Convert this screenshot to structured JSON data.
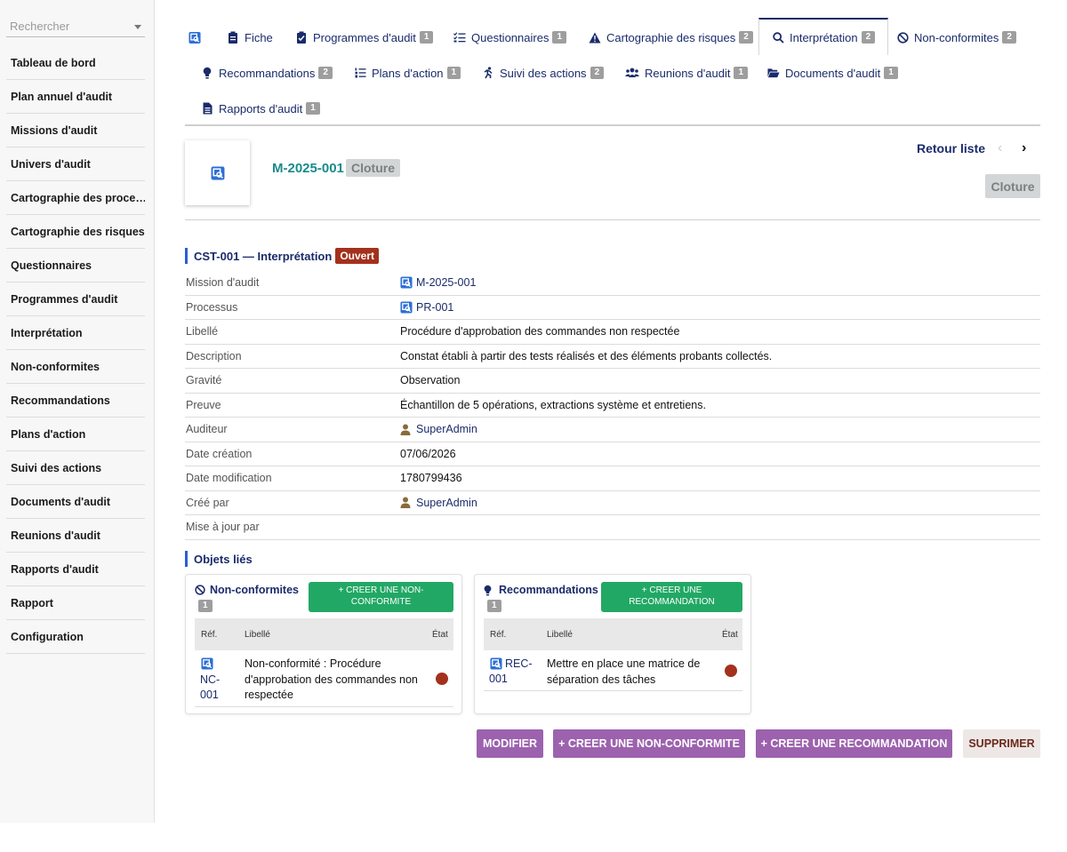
{
  "sidebar": {
    "search_placeholder": "Rechercher",
    "items": [
      {
        "label": "Tableau de bord"
      },
      {
        "label": "Plan annuel d'audit"
      },
      {
        "label": "Missions d'audit"
      },
      {
        "label": "Univers d'audit"
      },
      {
        "label": "Cartographie des proce…"
      },
      {
        "label": "Cartographie des risques"
      },
      {
        "label": "Questionnaires"
      },
      {
        "label": "Programmes d'audit"
      },
      {
        "label": "Interprétation"
      },
      {
        "label": "Non-conformites"
      },
      {
        "label": "Recommandations"
      },
      {
        "label": "Plans d'action"
      },
      {
        "label": "Suivi des actions"
      },
      {
        "label": "Documents d'audit"
      },
      {
        "label": "Reunions d'audit"
      },
      {
        "label": "Rapports d'audit"
      },
      {
        "label": "Rapport"
      },
      {
        "label": "Configuration"
      }
    ]
  },
  "tabs": [
    {
      "label": "Fiche",
      "badge": ""
    },
    {
      "label": "Programmes d'audit",
      "badge": "1"
    },
    {
      "label": "Questionnaires",
      "badge": "1"
    },
    {
      "label": "Cartographie des risques",
      "badge": "2"
    },
    {
      "label": "Interprétation",
      "badge": "2"
    },
    {
      "label": "Non-conformites",
      "badge": "2"
    },
    {
      "label": "Recommandations",
      "badge": "2"
    },
    {
      "label": "Plans d'action",
      "badge": "1"
    },
    {
      "label": "Suivi des actions",
      "badge": "2"
    },
    {
      "label": "Reunions d'audit",
      "badge": "1"
    },
    {
      "label": "Documents d'audit",
      "badge": "1"
    },
    {
      "label": "Rapports d'audit",
      "badge": "1"
    }
  ],
  "header": {
    "code": "M-2025-001",
    "status": "Cloture",
    "back_label": "Retour liste",
    "prev_glyph": "‹",
    "next_glyph": "›",
    "status_button": "Cloture"
  },
  "section": {
    "title": "CST-001 — Interprétation",
    "badge": "Ouvert"
  },
  "details": [
    {
      "label": "Mission d'audit",
      "value": "M-2025-001"
    },
    {
      "label": "Processus",
      "value": "PR-001"
    },
    {
      "label": "Libellé",
      "value": "Procédure d'approbation des commandes non respectée"
    },
    {
      "label": "Description",
      "value": "Constat établi à partir des tests réalisés et des éléments probants collectés."
    },
    {
      "label": "Gravité",
      "value": "Observation"
    },
    {
      "label": "Preuve",
      "value": "Échantillon de 5 opérations, extractions système et entretiens."
    },
    {
      "label": "Auditeur",
      "value": "SuperAdmin"
    },
    {
      "label": "Date création",
      "value": "07/06/2026"
    },
    {
      "label": "Date modification",
      "value": "1780799436"
    },
    {
      "label": "Créé par",
      "value": "SuperAdmin"
    },
    {
      "label": "Mise à jour par",
      "value": ""
    }
  ],
  "linked": {
    "title": "Objets liés",
    "nonconf": {
      "title": "Non-conformites",
      "count": "1",
      "create_line1": "+ CREER UNE NON-",
      "create_line2": "CONFORMITE",
      "col_ref": "Réf.",
      "col_label": "Libellé",
      "col_state": "État",
      "row_ref_1": "NC-",
      "row_ref_2": "001",
      "row_label": "Non-conformité : Procédure d'approbation des commandes non respectée",
      "state_color": "#a3311c"
    },
    "recos": {
      "title": "Recommandations",
      "count": "1",
      "create_line1": "+ CREER UNE",
      "create_line2": "RECOMMANDATION",
      "col_ref": "Réf.",
      "col_label": "Libellé",
      "col_state": "État",
      "row_ref_1": "REC-",
      "row_ref_2": "001",
      "row_label": "Mettre en place une matrice de séparation des tâches",
      "state_color": "#a3311c"
    }
  },
  "actions": {
    "modify": "MODIFIER",
    "create_nc": "+  CREER UNE NON-CONFORMITE",
    "create_reco": "+  CREER UNE RECOMMANDATION",
    "delete": "SUPPRIMER"
  },
  "colors": {
    "accent": "#1a2b6b",
    "teal": "#1a8a8a",
    "green": "#22a865",
    "purple": "#9c62ae",
    "danger": "#a3311c"
  }
}
